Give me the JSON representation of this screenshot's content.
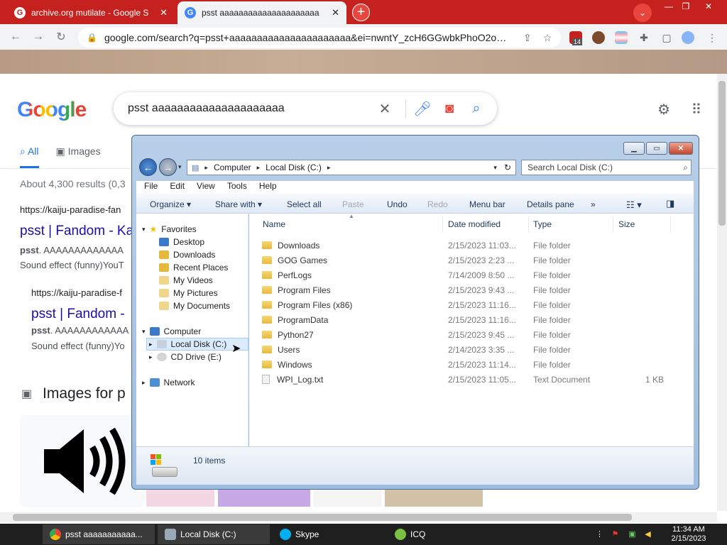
{
  "browser": {
    "tabs": [
      {
        "title": "archive.org mutilate - Google S",
        "active": false
      },
      {
        "title": "psst aaaaaaaaaaaaaaaaaaaaa",
        "active": true
      }
    ],
    "url": "google.com/search?q=psst+aaaaaaaaaaaaaaaaaaaaaa&ei=nwntY_zcH6GGwbkPhoO2o…",
    "extension_badge": "14"
  },
  "google": {
    "logo": "Google",
    "query": "psst aaaaaaaaaaaaaaaaaaaaa",
    "tabs": [
      "All",
      "Images"
    ],
    "results_count": "About 4,300 results (0,3",
    "results": [
      {
        "url": "https://kaiju-paradise-fan",
        "title": "psst | Fandom - Ka",
        "snippet_bold": "psst",
        "snippet": ". AAAAAAAAAAAAA",
        "snippet2": "Sound effect (funny)YouT"
      },
      {
        "url": "https://kaiju-paradise-f",
        "title": "psst | Fandom -",
        "snippet_bold": "psst",
        "snippet": ". AAAAAAAAAAAA",
        "snippet2": "Sound effect (funny)Yo"
      }
    ],
    "images_heading": "Images for p"
  },
  "explorer": {
    "path": [
      "Computer",
      "Local Disk (C:)"
    ],
    "search_placeholder": "Search Local Disk (C:)",
    "menu": [
      "File",
      "Edit",
      "View",
      "Tools",
      "Help"
    ],
    "commands": [
      {
        "label": "Organize ▾",
        "enabled": true
      },
      {
        "label": "Share with ▾",
        "enabled": true
      },
      {
        "label": "Select all",
        "enabled": true
      },
      {
        "label": "Paste",
        "enabled": false
      },
      {
        "label": "Undo",
        "enabled": true
      },
      {
        "label": "Redo",
        "enabled": false
      },
      {
        "label": "Menu bar",
        "enabled": true
      },
      {
        "label": "Details pane",
        "enabled": true
      },
      {
        "label": "»",
        "enabled": true
      }
    ],
    "nav": {
      "favorites_label": "Favorites",
      "favorites": [
        "Desktop",
        "Downloads",
        "Recent Places",
        "My Videos",
        "My Pictures",
        "My Documents"
      ],
      "computer_label": "Computer",
      "drives": [
        "Local Disk (C:)",
        "CD Drive (E:)"
      ],
      "network_label": "Network"
    },
    "columns": [
      "Name",
      "Date modified",
      "Type",
      "Size"
    ],
    "files": [
      {
        "name": "Downloads",
        "date": "2/15/2023 11:03...",
        "type": "File folder",
        "size": "",
        "kind": "folder"
      },
      {
        "name": "GOG Games",
        "date": "2/15/2023 2:23 ...",
        "type": "File folder",
        "size": "",
        "kind": "folder"
      },
      {
        "name": "PerfLogs",
        "date": "7/14/2009 8:50 ...",
        "type": "File folder",
        "size": "",
        "kind": "folder"
      },
      {
        "name": "Program Files",
        "date": "2/15/2023 9:43 ...",
        "type": "File folder",
        "size": "",
        "kind": "folder"
      },
      {
        "name": "Program Files (x86)",
        "date": "2/15/2023 11:16...",
        "type": "File folder",
        "size": "",
        "kind": "folder"
      },
      {
        "name": "ProgramData",
        "date": "2/15/2023 11:16...",
        "type": "File folder",
        "size": "",
        "kind": "folder"
      },
      {
        "name": "Python27",
        "date": "2/15/2023 9:45 ...",
        "type": "File folder",
        "size": "",
        "kind": "folder"
      },
      {
        "name": "Users",
        "date": "2/14/2023 3:35 ...",
        "type": "File folder",
        "size": "",
        "kind": "folder"
      },
      {
        "name": "Windows",
        "date": "2/15/2023 11:14...",
        "type": "File folder",
        "size": "",
        "kind": "folder"
      },
      {
        "name": "WPI_Log.txt",
        "date": "2/15/2023 11:05...",
        "type": "Text Document",
        "size": "1 KB",
        "kind": "file"
      }
    ],
    "item_count": "10 items"
  },
  "taskbar": {
    "items": [
      {
        "label": "psst aaaaaaaaaaa...",
        "icon": "chrome-icon",
        "color": "#4285f4"
      },
      {
        "label": "Local Disk (C:)",
        "icon": "drive-icon",
        "color": "#9aa9b8"
      },
      {
        "label": "Skype",
        "icon": "skype-icon",
        "color": "#00aff0"
      },
      {
        "label": "ICQ",
        "icon": "icq-icon",
        "color": "#7ac143"
      }
    ],
    "time": "11:34 AM",
    "date": "2/15/2023"
  }
}
